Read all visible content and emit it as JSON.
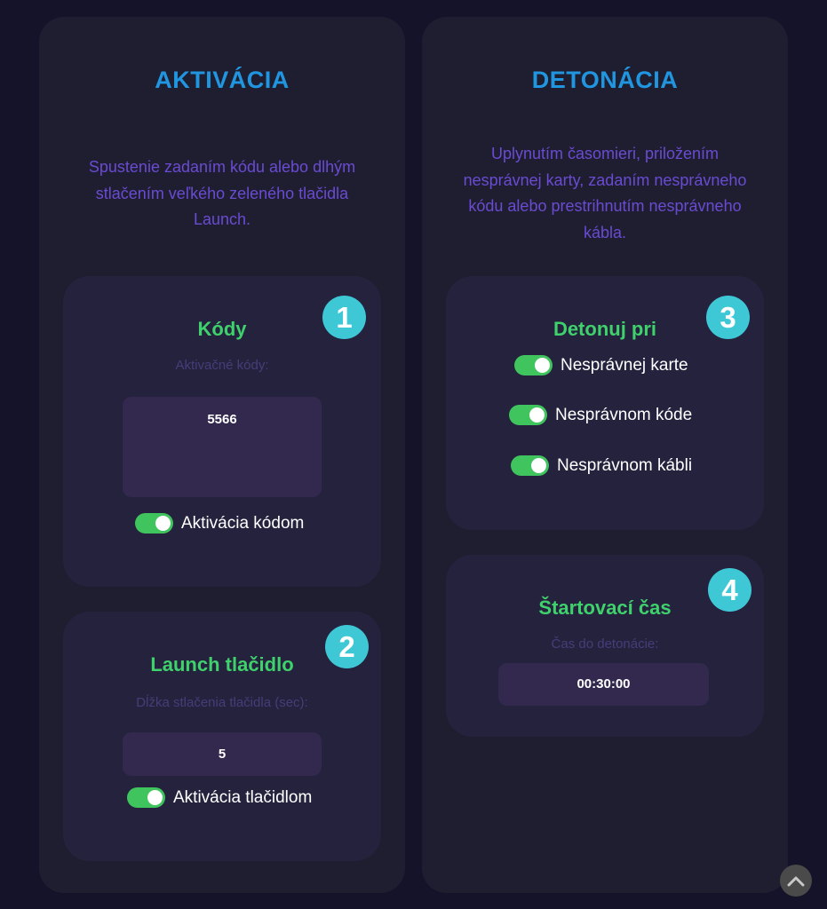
{
  "activation": {
    "title": "AKTIVÁCIA",
    "description": "Spustenie zadaním kódu alebo dlhým stlačením veľkého zeleného tlačidla Launch.",
    "codes_card": {
      "badge": "1",
      "title": "Kódy",
      "label": "Aktivačné kódy:",
      "value": "5566",
      "toggle_label": "Aktivácia kódom",
      "toggle_on": true
    },
    "launch_card": {
      "badge": "2",
      "title": "Launch tlačidlo",
      "label": "Dĺžka stlačenia tlačidla (sec):",
      "value": "5",
      "toggle_label": "Aktivácia tlačidlom",
      "toggle_on": true
    }
  },
  "detonation": {
    "title": "DETONÁCIA",
    "description": "Uplynutím časomieri, priložením nesprávnej karty, zadaním nesprávneho kódu alebo prestrihnutím nesprávneho kábla.",
    "detonate_card": {
      "badge": "3",
      "title": "Detonuj pri",
      "toggles": [
        {
          "label": "Nesprávnej karte",
          "on": true
        },
        {
          "label": "Nesprávnom kóde",
          "on": true
        },
        {
          "label": "Nesprávnom kábli",
          "on": true
        }
      ]
    },
    "time_card": {
      "badge": "4",
      "title": "Štartovací čas",
      "label": "Čas do detonácie:",
      "value": "00:30:00"
    }
  },
  "colors": {
    "background": "#14132a",
    "panel": "#1f1e31",
    "card": "#25223e",
    "heading_blue": "#2196e0",
    "description_purple": "#6a4bd1",
    "card_title_green": "#3fd16b",
    "badge_cyan": "#3ec8d6",
    "switch_green": "#3fc45e"
  },
  "icons": {
    "scroll_top": "chevron-up-icon"
  }
}
